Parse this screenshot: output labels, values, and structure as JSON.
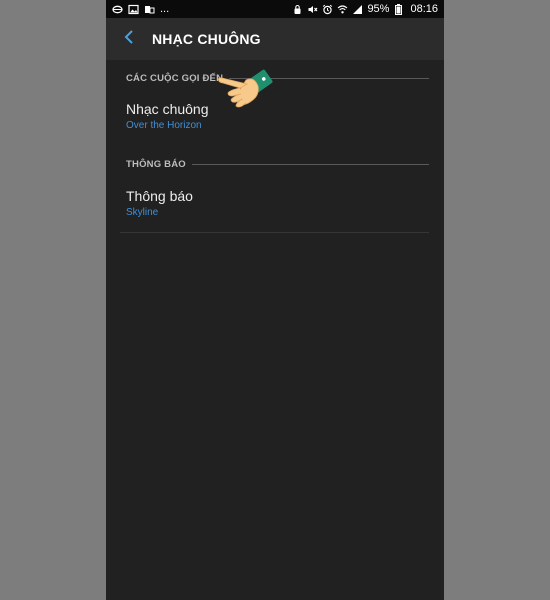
{
  "status_bar": {
    "left_icons": [
      "sync-icon",
      "image-icon",
      "dual-phone-icon"
    ],
    "overflow": "...",
    "right_icons": [
      "alarm-lock-icon",
      "mute-icon",
      "alarm-icon",
      "wifi-icon",
      "signal-icon"
    ],
    "battery_percent": "95%",
    "time": "08:16"
  },
  "app_bar": {
    "back_icon": "chevron-left-icon",
    "title": "NHẠC CHUÔNG"
  },
  "sections": [
    {
      "header": "CÁC CUỘC GỌI ĐẾN",
      "items": [
        {
          "title": "Nhạc chuông",
          "summary": "Over the Horizon"
        }
      ]
    },
    {
      "header": "THÔNG BÁO",
      "items": [
        {
          "title": "Thông báo",
          "summary": "Skyline"
        }
      ]
    }
  ],
  "overlay": {
    "icon": "pointing-hand-icon"
  },
  "colors": {
    "background_outside": "#7d7d7d",
    "screen_bg": "#212121",
    "app_bar_bg": "#2c2c2c",
    "accent_blue": "#3f8fd6",
    "back_arrow": "#4aa3e0",
    "hand_skin": "#f7c98b",
    "hand_cuff": "#1f8f70"
  }
}
